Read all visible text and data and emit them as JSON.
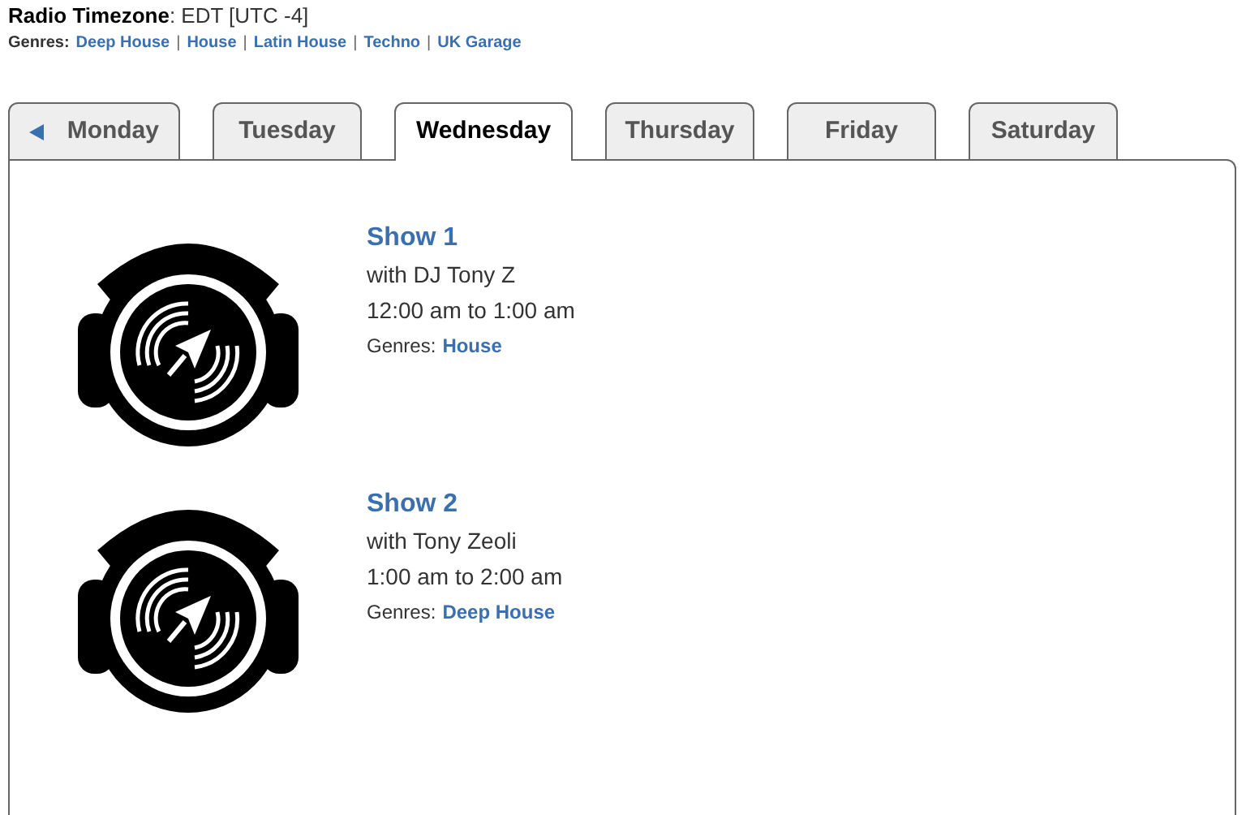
{
  "header": {
    "timezone_label": "Radio Timezone",
    "timezone_value": ": EDT [UTC -4]",
    "genres_label": "Genres:",
    "separator": "|",
    "genres": [
      "Deep House",
      "House",
      "Latin House",
      "Techno",
      "UK Garage"
    ]
  },
  "tabs": [
    {
      "label": "Monday",
      "selected": false
    },
    {
      "label": "Tuesday",
      "selected": false
    },
    {
      "label": "Wednesday",
      "selected": true
    },
    {
      "label": "Thursday",
      "selected": false
    },
    {
      "label": "Friday",
      "selected": false
    },
    {
      "label": "Saturday",
      "selected": false
    }
  ],
  "shows": [
    {
      "title": "Show 1",
      "host": "with DJ Tony Z",
      "time": "12:00 am to 1:00 am",
      "genres_label": "Genres:",
      "genres": "House"
    },
    {
      "title": "Show 2",
      "host": "with Tony Zeoli",
      "time": "1:00 am to 2:00 am",
      "genres_label": "Genres:",
      "genres": "Deep House"
    }
  ]
}
